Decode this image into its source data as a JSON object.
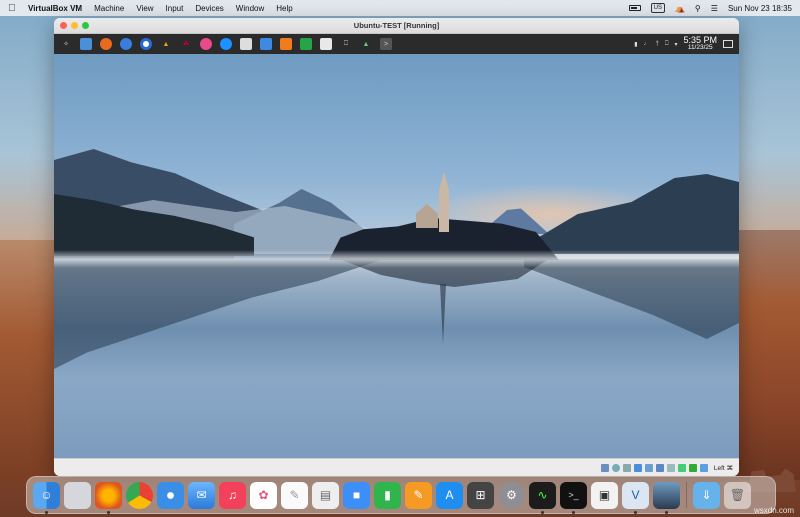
{
  "menubar": {
    "app_name": "VirtualBox VM",
    "menus": [
      "Machine",
      "View",
      "Input",
      "Devices",
      "Window",
      "Help"
    ],
    "input_source": "US",
    "datetime": "Sun Nov 23  18:35"
  },
  "vm_window": {
    "title": "Ubuntu-TEST [Running]"
  },
  "guest_panel": {
    "launchers": [
      "apps-icon",
      "files-icon",
      "firefox-icon",
      "chrome-icon",
      "vlc-icon",
      "app-icon",
      "app-icon",
      "app-icon",
      "app-icon",
      "document-icon",
      "document-icon",
      "spreadsheet-icon",
      "document-icon",
      "monitor-icon",
      "image-icon",
      "terminal-icon"
    ],
    "clock_time": "5:35 PM",
    "clock_date": "11/23/25"
  },
  "status_bar": {
    "host_key": "Left ⌘"
  },
  "dock": {
    "apps": [
      "Finder",
      "Launchpad",
      "Firefox",
      "Chrome",
      "Safari",
      "Mail",
      "Music",
      "Photos",
      "TextEdit",
      "Preview",
      "Keynote",
      "Numbers",
      "Pages",
      "App Store",
      "Calculator",
      "System Settings",
      "Activity Monitor",
      "Terminal",
      "Screenshot",
      "VirtualBox",
      "VM Preview"
    ],
    "extras": [
      "Downloads",
      "Trash"
    ]
  },
  "watermark": "wsxdn.com",
  "colors": {
    "panel_bg": "#2b2b2b",
    "close": "#fe5f57",
    "minimize": "#febc2e",
    "maximize": "#28c840"
  }
}
